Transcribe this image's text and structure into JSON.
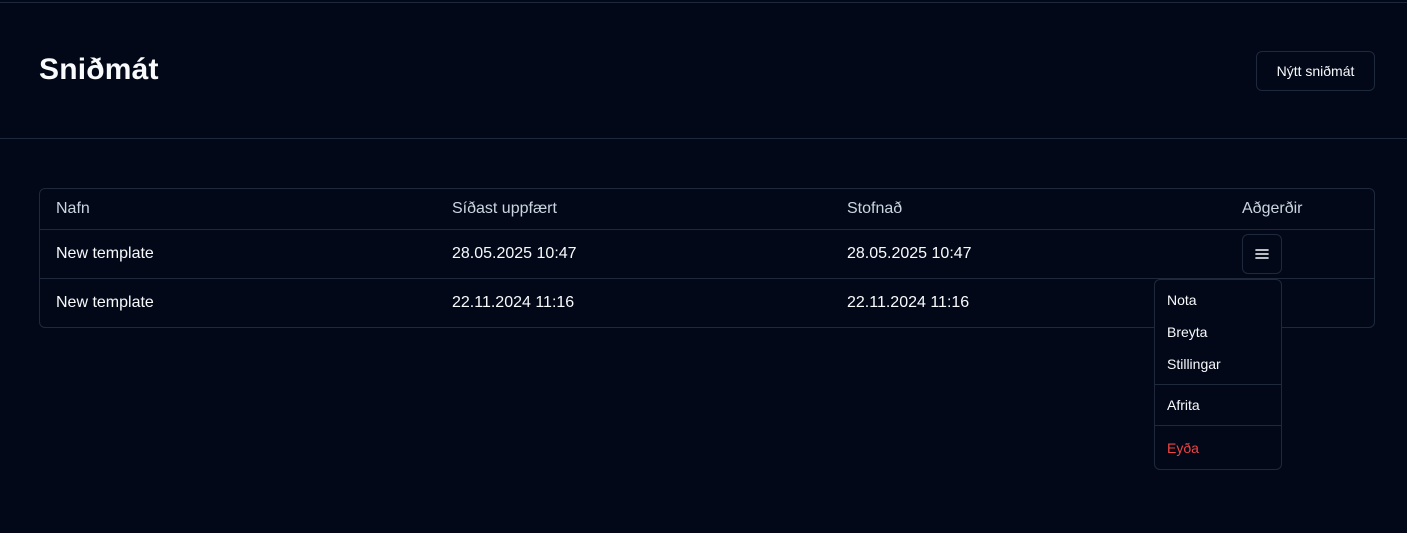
{
  "header": {
    "title": "Sniðmát",
    "new_button_label": "Nýtt sniðmát"
  },
  "table": {
    "columns": [
      "Nafn",
      "Síðast uppfært",
      "Stofnað",
      "Aðgerðir"
    ],
    "rows": [
      {
        "name": "New template",
        "updated": "28.05.2025 10:47",
        "created": "28.05.2025 10:47"
      },
      {
        "name": "New template",
        "updated": "22.11.2024 11:16",
        "created": "22.11.2024 11:16"
      }
    ]
  },
  "actions_menu": {
    "items": [
      "Nota",
      "Breyta",
      "Stillingar",
      "Afrita",
      "Eyða"
    ],
    "danger_color": "#ef4444"
  },
  "icons": {
    "menu_button": "hamburger-icon"
  }
}
